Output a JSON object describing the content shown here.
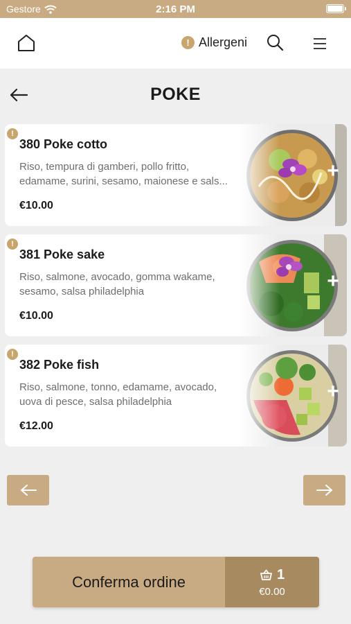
{
  "status": {
    "carrier": "Gestore",
    "time": "2:16 PM"
  },
  "header": {
    "allergens_label": "Allergeni",
    "alert_symbol": "!"
  },
  "page": {
    "title": "POKE"
  },
  "products": [
    {
      "name": "380 Poke cotto",
      "description": "Riso, tempura di gamberi, pollo fritto, edamame, surini, sesamo, maionese e sals...",
      "price": "€10.00",
      "add_symbol": "+"
    },
    {
      "name": "381 Poke sake",
      "description": "Riso, salmone, avocado, gomma wakame, sesamo, salsa philadelphia",
      "price": "€10.00",
      "add_symbol": "+"
    },
    {
      "name": "382 Poke fish",
      "description": "Riso, salmone, tonno, edamame, avocado, uova di pesce, salsa philadelphia",
      "price": "€12.00",
      "add_symbol": "+"
    }
  ],
  "order": {
    "confirm_label": "Conferma ordine",
    "cart_count": "1",
    "cart_total": "€0.00"
  },
  "colors": {
    "accent": "#c8ab82",
    "accent_dark": "#a88a61",
    "alert": "#c8a46e",
    "background": "#efefef"
  },
  "icons": [
    "wifi-icon",
    "battery-icon",
    "home-icon",
    "alert-icon",
    "search-icon",
    "hamburger-menu-icon",
    "back-arrow-icon",
    "plus-icon",
    "arrow-left-icon",
    "arrow-right-icon",
    "basket-icon"
  ]
}
